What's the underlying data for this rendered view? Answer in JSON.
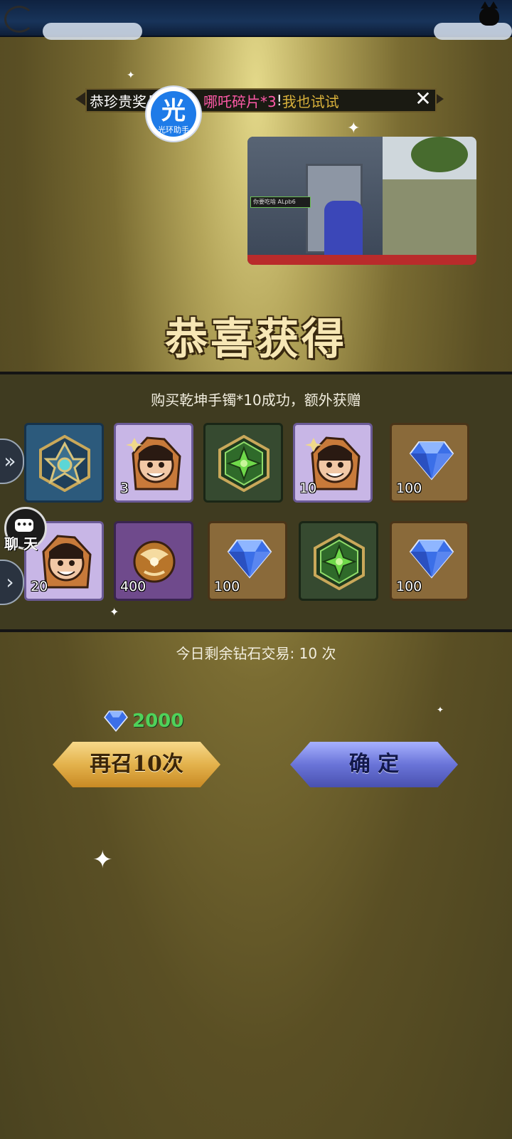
{
  "marquee": {
    "text_white": "恭珍贵奖品",
    "text_pink": "哪吒碎片*3",
    "text_exclaim": "!",
    "text_gold": "我也试试",
    "close_icon": "close-x-icon"
  },
  "overlay_badge": {
    "glyph": "光",
    "label": "光环助手"
  },
  "video": {
    "hud_text": "你要吃啥 ALpb6"
  },
  "title": "恭喜获得",
  "subtitle": "购买乾坤手镯*10成功，额外获赠",
  "rewards": [
    {
      "icon": "hexagram-badge-icon",
      "bg": "blue",
      "count": ""
    },
    {
      "icon": "nezha-fragment-icon",
      "bg": "purple",
      "count": "3"
    },
    {
      "icon": "green-hex-emblem-icon",
      "bg": "green",
      "count": ""
    },
    {
      "icon": "nezha-fragment-icon",
      "bg": "purple",
      "count": "10"
    },
    {
      "icon": "diamond-icon",
      "bg": "brown",
      "count": "100"
    },
    {
      "icon": "nezha-fragment-icon",
      "bg": "purple",
      "count": "20"
    },
    {
      "icon": "golden-orb-fragment-icon",
      "bg": "violet",
      "count": "400"
    },
    {
      "icon": "diamond-icon",
      "bg": "brown",
      "count": "100"
    },
    {
      "icon": "green-hex-emblem-icon",
      "bg": "green",
      "count": ""
    },
    {
      "icon": "diamond-icon",
      "bg": "brown",
      "count": "100"
    }
  ],
  "side": {
    "expand_icon": "double-chevron-right-icon",
    "chat_label": "聊 天",
    "next_icon": "chevron-right-icon"
  },
  "remaining_text": "今日剩余钻石交易: 10 次",
  "cost": {
    "icon": "diamond-icon",
    "value": "2000"
  },
  "buttons": {
    "summon_again": "再召10次",
    "confirm": "确 定"
  },
  "colors": {
    "cost_green": "#4fd25a",
    "marquee_pink": "#ff5aa8",
    "marquee_gold": "#d9b13b"
  }
}
